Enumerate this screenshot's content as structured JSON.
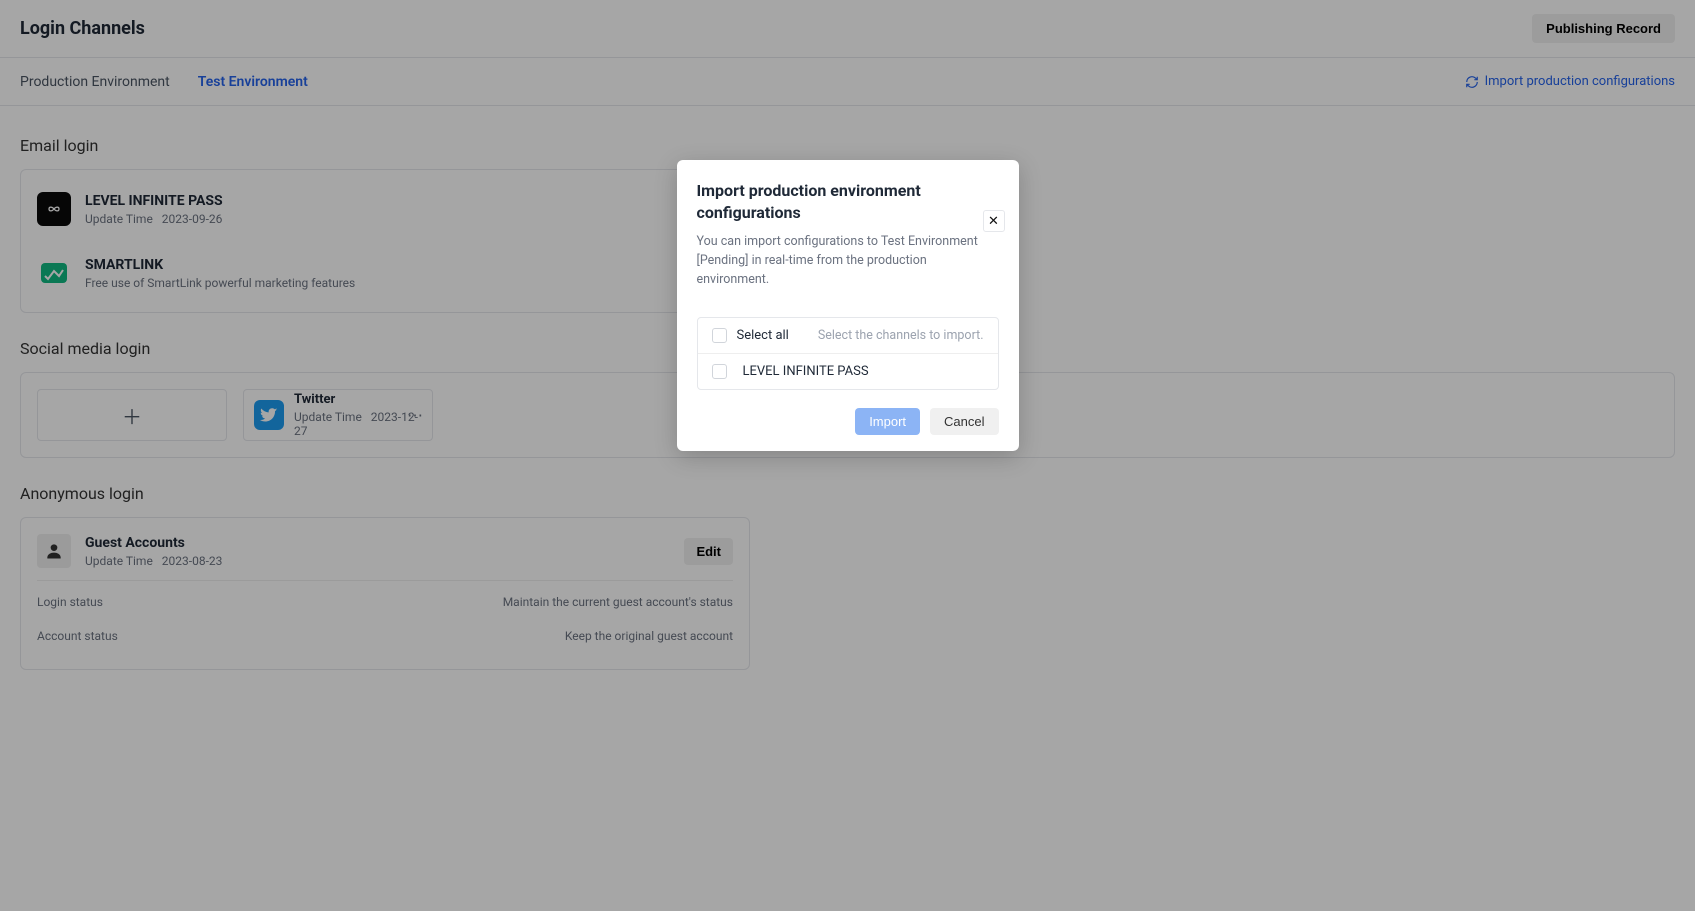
{
  "header": {
    "title": "Login Channels",
    "publishing_record": "Publishing Record"
  },
  "tabs": {
    "production": "Production Environment",
    "test": "Test Environment",
    "import_link": "Import production configurations"
  },
  "sections": {
    "email": {
      "title": "Email login",
      "items": [
        {
          "name": "LEVEL INFINITE PASS",
          "update_label": "Update Time",
          "update_time": "2023-09-26"
        },
        {
          "name": "SMARTLINK",
          "sub": "Free use of SmartLink powerful marketing features"
        }
      ]
    },
    "social": {
      "title": "Social media login",
      "twitter": {
        "name": "Twitter",
        "update_label": "Update Time",
        "update_time": "2023-12-27"
      }
    },
    "anonymous": {
      "title": "Anonymous login",
      "guest": {
        "name": "Guest Accounts",
        "update_label": "Update Time",
        "update_time": "2023-08-23",
        "edit": "Edit"
      },
      "rows": [
        {
          "label": "Login status",
          "value": "Maintain the current guest account's status"
        },
        {
          "label": "Account status",
          "value": "Keep the original guest account"
        }
      ]
    }
  },
  "modal": {
    "title": "Import production environment configurations",
    "desc": "You can import configurations to Test Environment [Pending] in real-time from the production environment.",
    "select_all": "Select all",
    "hint": "Select the channels to import.",
    "item": "LEVEL INFINITE PASS",
    "import_btn": "Import",
    "cancel_btn": "Cancel"
  }
}
